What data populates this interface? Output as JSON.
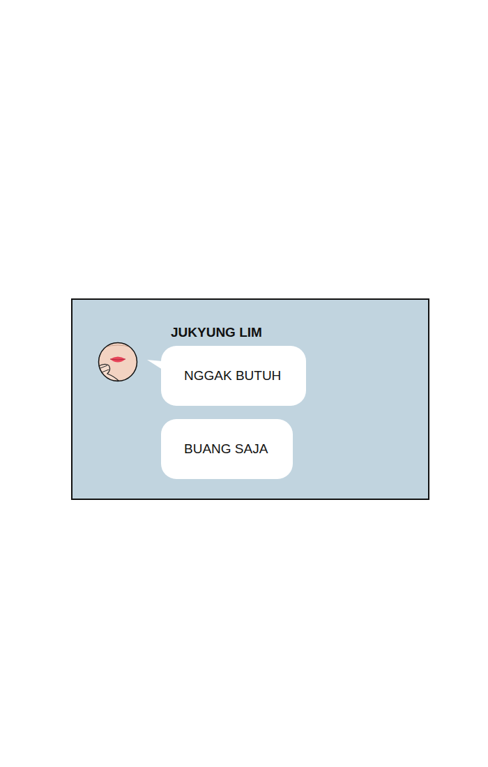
{
  "chat": {
    "sender": "JUKYUNG LIM",
    "messages": [
      {
        "text": "NGGAK BUTUH"
      },
      {
        "text": "BUANG SAJA"
      }
    ]
  }
}
